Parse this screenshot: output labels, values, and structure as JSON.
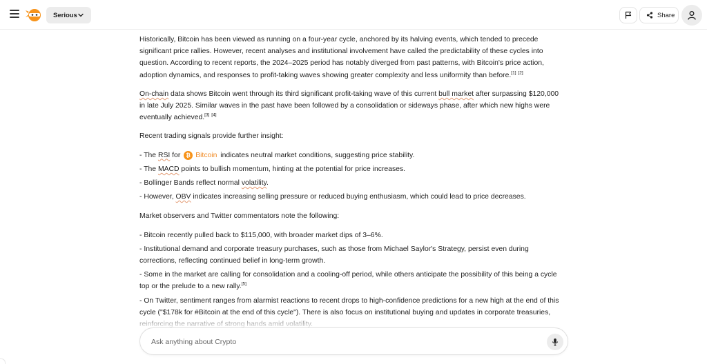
{
  "header": {
    "mode_label": "Serious",
    "share_label": "Share",
    "icons": [
      "hamburger-menu-icon",
      "ninja-logo-icon",
      "chevron-down-icon",
      "flag-icon",
      "share-icon",
      "user-icon"
    ]
  },
  "article": {
    "p1": {
      "text": "Historically, Bitcoin has been viewed as running on a four-year cycle, anchored by its halving events, which tended to precede significant price rallies. However, recent analyses and institutional involvement have called the predictability of these cycles into question. According to recent reports, the 2024–2025 period has notably diverged from past patterns, with Bitcoin's price action, adoption dynamics, and responses to profit-taking waves showing greater complexity and less uniformity than before.",
      "refs": [
        "[1]",
        "[2]"
      ]
    },
    "p2": {
      "t1": "On-chain",
      "t2": " data shows Bitcoin went through its third significant profit-taking wave of this current ",
      "t3": "bull market",
      "t4": " after surpassing $120,000 in late July 2025. Similar waves in the past have been followed by a consolidation or sideways phase, after which new highs were eventually achieved.",
      "refs": [
        "[3]",
        "[4]"
      ]
    },
    "p3": "Recent trading signals provide further insight:",
    "signals": {
      "rsi_a": "- The ",
      "rsi_term": "RSI",
      "rsi_b": " for ",
      "coin_symbol": "₿",
      "coin_name": "Bitcoin",
      "rsi_c": " indicates neutral market conditions, suggesting price stability.",
      "macd_a": "- The ",
      "macd_term": "MACD",
      "macd_b": " points to bullish momentum, hinting at the potential for price increases.",
      "bb_a": "- Bollinger Bands reflect normal ",
      "bb_term": "volatility",
      "bb_b": ".",
      "obv_a": "- However, ",
      "obv_term": "OBV",
      "obv_b": " indicates increasing selling pressure or reduced buying enthusiasm, which could lead to price decreases."
    },
    "p4": "Market observers and Twitter commentators note the following:",
    "observations": {
      "o1": "- Bitcoin recently pulled back to $115,000, with broader market dips of 3–6%.",
      "o2": "- Institutional demand and corporate treasury purchases, such as those from Michael Saylor's Strategy, persist even during corrections, reflecting continued belief in long-term growth.",
      "o3": "- Some in the market are calling for consolidation and a cooling-off period, while others anticipate the possibility of this being a cycle top or the prelude to a new rally.",
      "o3_ref": "[5]",
      "o4": "- On Twitter, sentiment ranges from alarmist reactions to recent drops to high-confidence predictions for a new high at the end of this cycle (\"$178k for #Bitcoin at the end of this cycle\"). There is also focus on institutional buying and updates in corporate treasuries, reinforcing the narrative of strong hands amid volatility."
    }
  },
  "composer": {
    "placeholder": "Ask anything about Crypto",
    "icons": [
      "microphone-icon"
    ]
  },
  "colors": {
    "accent_orange": "#f08a24",
    "bitcoin_orange": "#f7931a",
    "spellcheck_underline": "#e39a72",
    "button_gray": "#ececec"
  }
}
